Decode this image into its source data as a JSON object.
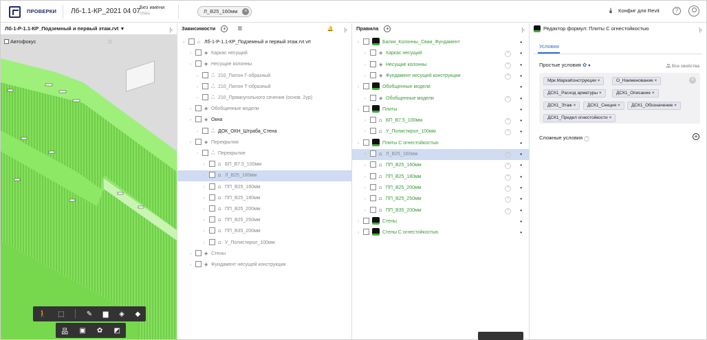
{
  "topbar": {
    "brand": "ПРОВЕРКИ",
    "project": "Лб-1.1-КР_2021 04 07",
    "user_title": "Без имени",
    "user_sub": "Ussu",
    "active_chip": "Л_В25_160мм",
    "config": "Конфиг для Revit",
    "help": "?"
  },
  "viewer": {
    "title": "Лб-1-Р-1.1-КР_Подземный и первый этаж.rvt",
    "autofocus": "Автофокус"
  },
  "deps": {
    "title": "Зависимости",
    "rows": [
      {
        "label": "Лб-1-Р-1.1-КР_Подземный и первый этаж.rvt",
        "style": "dark",
        "indent": 0,
        "icon": "home-icon",
        "tail": "vrt"
      },
      {
        "label": "Каркас несущий",
        "style": "",
        "indent": 1,
        "icon": "layers-icon"
      },
      {
        "label": "Несущие колонны",
        "style": "",
        "indent": 1,
        "icon": "layers-icon"
      },
      {
        "label": "210_Пилон Г-образный",
        "style": "",
        "indent": 2,
        "icon": "family-icon"
      },
      {
        "label": "210_Пилон Т-образный",
        "style": "",
        "indent": 2,
        "icon": "family-icon"
      },
      {
        "label": "210_Прямоугольного сечения (основ. 2ур)",
        "style": "",
        "indent": 2,
        "icon": "family-icon"
      },
      {
        "label": "Обобщенные модели",
        "style": "",
        "indent": 1,
        "icon": "layers-icon"
      },
      {
        "label": "Окна",
        "style": "dark",
        "indent": 1,
        "icon": "layers-icon"
      },
      {
        "label": "ДОК_ОКН_Штраба_Стена",
        "style": "dark",
        "indent": 2,
        "icon": "family-icon"
      },
      {
        "label": "Перекрытия",
        "style": "",
        "indent": 1,
        "icon": "layers-icon"
      },
      {
        "label": "Перекрытие",
        "style": "",
        "indent": 2,
        "icon": "family-icon"
      },
      {
        "label": "БП_В7.5_100мм",
        "style": "",
        "indent": 3,
        "icon": "type-icon"
      },
      {
        "label": "Л_В25_160мм",
        "style": "sel",
        "indent": 3,
        "icon": "type-icon"
      },
      {
        "label": "ПП_В25_160мм",
        "style": "",
        "indent": 3,
        "icon": "type-icon"
      },
      {
        "label": "ПП_В25_180мм",
        "style": "",
        "indent": 3,
        "icon": "type-icon"
      },
      {
        "label": "ПП_В25_200мм",
        "style": "",
        "indent": 3,
        "icon": "type-icon"
      },
      {
        "label": "ПП_В25_250мм",
        "style": "",
        "indent": 3,
        "icon": "type-icon"
      },
      {
        "label": "ПП_В35_200мм",
        "style": "",
        "indent": 3,
        "icon": "type-icon"
      },
      {
        "label": "У_Полистирол_100мм",
        "style": "",
        "indent": 3,
        "icon": "type-icon"
      },
      {
        "label": "Стены",
        "style": "",
        "indent": 1,
        "icon": "layers-icon"
      },
      {
        "label": "Фундамент несущей конструкции",
        "style": "",
        "indent": 1,
        "icon": "layers-icon"
      }
    ]
  },
  "rules": {
    "title": "Правила",
    "rows": [
      {
        "label": "Балки_Колонны_Сваи_Фундамент",
        "style": "green",
        "head": true,
        "icon": ""
      },
      {
        "label": "Каркас несущий",
        "style": "green",
        "head": false,
        "icon": "layers-icon"
      },
      {
        "label": "Несущие колонны",
        "style": "green",
        "head": false,
        "icon": "layers-icon"
      },
      {
        "label": "Фундамент несущей конструкции",
        "style": "green",
        "head": false,
        "icon": "layers-icon"
      },
      {
        "label": "Обобщенные модели",
        "style": "green",
        "head": true,
        "icon": ""
      },
      {
        "label": "Обобщенные модели",
        "style": "green",
        "head": false,
        "icon": "layers-icon"
      },
      {
        "label": "Плиты",
        "style": "green",
        "head": true,
        "icon": ""
      },
      {
        "label": "БП_В7.5_100мм",
        "style": "green",
        "head": false,
        "icon": "type-icon"
      },
      {
        "label": "У_Полистирол_100мм",
        "style": "green",
        "head": false,
        "icon": "type-icon"
      },
      {
        "label": "Плиты С огнестойкостью",
        "style": "green",
        "head": true,
        "icon": ""
      },
      {
        "label": "Л_В25_160мм",
        "style": "sel",
        "head": false,
        "icon": "type-icon"
      },
      {
        "label": "ПП_В25_160мм",
        "style": "green",
        "head": false,
        "icon": "type-icon"
      },
      {
        "label": "ПП_В25_180мм",
        "style": "green",
        "head": false,
        "icon": "type-icon"
      },
      {
        "label": "ПП_В25_200мм",
        "style": "green",
        "head": false,
        "icon": "type-icon"
      },
      {
        "label": "ПП_В25_250мм",
        "style": "green",
        "head": false,
        "icon": "type-icon"
      },
      {
        "label": "ПП_В35_200мм",
        "style": "green",
        "head": false,
        "icon": "type-icon"
      },
      {
        "label": "Стены",
        "style": "green",
        "head": true,
        "icon": ""
      },
      {
        "label": "Стены С огнестойкостью",
        "style": "green",
        "head": true,
        "icon": ""
      }
    ]
  },
  "editor": {
    "title": "Редактор формул: Плиты С огнестойкостью",
    "tab": "Условия",
    "simple_label": "Простые условия",
    "all_props": "Все свойства",
    "complex_label": "Сложные условия",
    "tags": [
      "Мрк.МаркаКонструкции",
      "О_Наименование",
      "ДСК1_Расход арматуры",
      "ДСК1_Описание",
      "ДСК1_Этаж",
      "ДСК1_Секция",
      "ДСК1_Обозначение",
      "ДСК1_Предел огнестойкости"
    ]
  },
  "colors": {
    "accent": "#2f6fc4",
    "green": "#3a9a3a",
    "model": "#7fe05a"
  }
}
